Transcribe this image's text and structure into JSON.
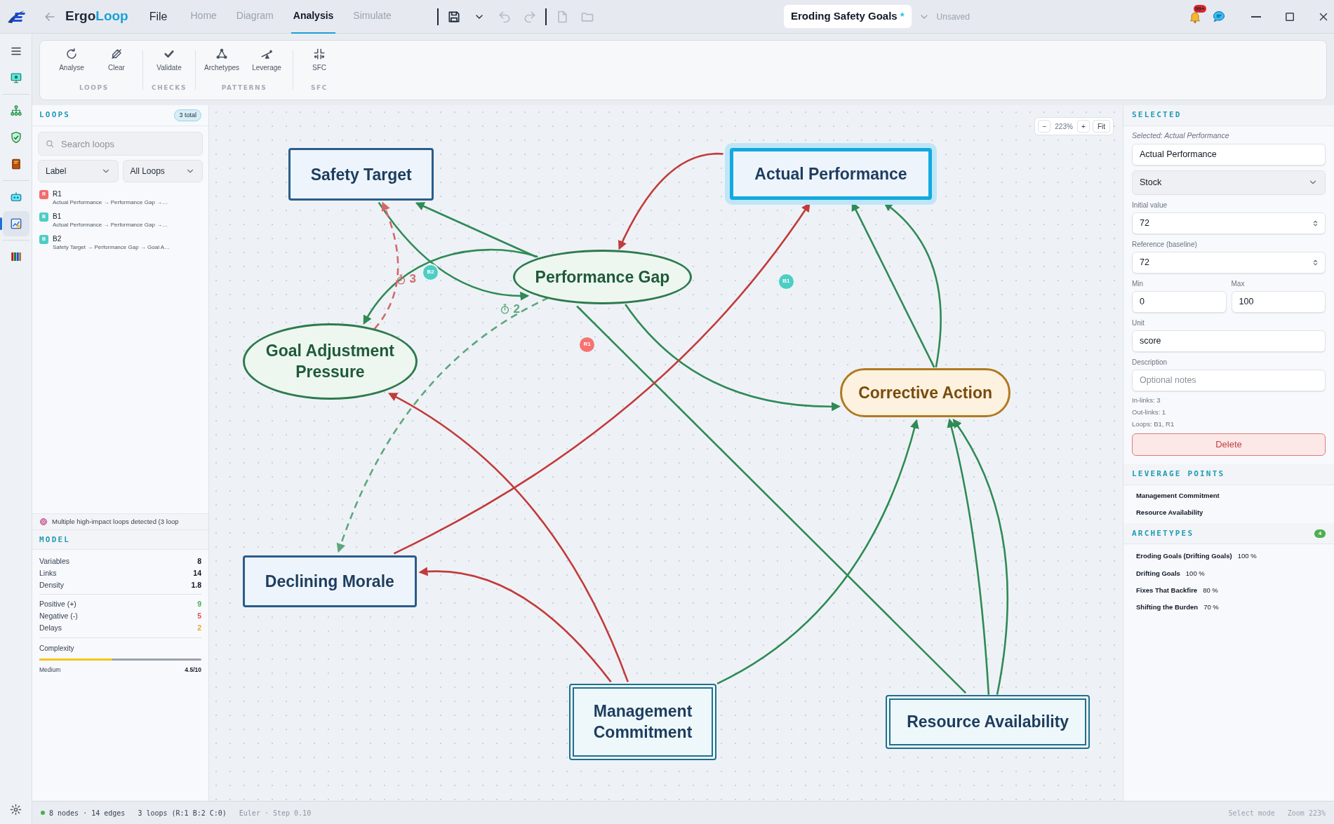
{
  "app": {
    "name_start": "Ergo",
    "name_end": "Loop"
  },
  "menu": {
    "label": "File"
  },
  "nav_tabs": [
    {
      "label": "Home",
      "selected": false
    },
    {
      "label": "Diagram",
      "selected": false
    },
    {
      "label": "Analysis",
      "selected": true
    },
    {
      "label": "Simulate",
      "selected": false
    }
  ],
  "quick_tools": [
    {
      "kind": "save",
      "disabled": false
    },
    {
      "kind": "dropdown",
      "disabled": false
    },
    {
      "kind": "undo",
      "disabled": true
    },
    {
      "kind": "redo",
      "disabled": true
    },
    {
      "kind": "new-file",
      "disabled": true
    },
    {
      "kind": "open-folder",
      "disabled": true
    }
  ],
  "document": {
    "title": "Eroding Safety Goals",
    "modified_mark": "*",
    "status": "Unsaved"
  },
  "notifications": {
    "count": "99+"
  },
  "rail": [
    {
      "items": [
        {
          "kind": "menu",
          "selected": false
        },
        {
          "kind": "monitor",
          "selected": false
        }
      ]
    },
    {
      "items": [
        {
          "kind": "network",
          "selected": false
        },
        {
          "kind": "shield",
          "selected": false
        },
        {
          "kind": "book",
          "selected": false
        }
      ]
    },
    {
      "items": [
        {
          "kind": "robot",
          "selected": false
        },
        {
          "kind": "dashboard",
          "selected": true
        }
      ]
    },
    {
      "items": [
        {
          "kind": "books",
          "selected": false
        }
      ]
    }
  ],
  "ribbon": [
    {
      "label": "LOOPS",
      "tools": [
        {
          "kind": "analyse",
          "label": "Analyse"
        },
        {
          "kind": "clear",
          "label": "Clear"
        }
      ]
    },
    {
      "label": "CHECKS",
      "tools": [
        {
          "kind": "validate",
          "label": "Validate"
        }
      ]
    },
    {
      "label": "PATTERNS",
      "tools": [
        {
          "kind": "archetypes",
          "label": "Archetypes"
        },
        {
          "kind": "leverage",
          "label": "Leverage"
        }
      ]
    },
    {
      "label": "SFC",
      "tools": [
        {
          "kind": "sfc",
          "label": "SFC"
        }
      ]
    }
  ],
  "loops_panel": {
    "title": "LOOPS",
    "count": "3 total",
    "search": {
      "placeholder": "Search loops"
    },
    "filters": [
      {
        "value": "Label"
      },
      {
        "value": "All Loops"
      }
    ],
    "loops": [
      {
        "letter": "R",
        "name": "R1",
        "path": "Actual Performance → Performance Gap →…",
        "color": "#f26d6d"
      },
      {
        "letter": "B",
        "name": "B1",
        "path": "Actual Performance → Performance Gap →…",
        "color": "#4ecdc4"
      },
      {
        "letter": "B",
        "name": "B2",
        "path": "Safety Target → Performance Gap → Goal A…",
        "color": "#4ecdc4"
      }
    ],
    "alert": "Multiple high-impact loops detected (3 loop"
  },
  "model": {
    "title": "MODEL",
    "stat_groups": [
      {
        "stats": [
          {
            "label": "Variables",
            "value": "8",
            "kind": "plain"
          },
          {
            "label": "Links",
            "value": "14",
            "kind": "plain"
          },
          {
            "label": "Density",
            "value": "1.8",
            "kind": "plain"
          }
        ]
      },
      {
        "stats": [
          {
            "label": "Positive (+)",
            "value": "9",
            "kind": "positive"
          },
          {
            "label": "Negative (-)",
            "value": "5",
            "kind": "negative"
          },
          {
            "label": "Delays",
            "value": "2",
            "kind": "delay"
          }
        ]
      }
    ],
    "complexity": {
      "label": "Complexity",
      "level": 0.45,
      "rating": "Medium",
      "score": "4.5/10"
    }
  },
  "canvas": {
    "nodes": [
      {
        "label": "Safety Target",
        "kind": "stock",
        "selected": false
      },
      {
        "label": "Actual Performance",
        "kind": "stock",
        "selected": true
      },
      {
        "label": "Performance Gap",
        "kind": "variable",
        "selected": false
      },
      {
        "label": "Goal Adjustment Pressure",
        "kind": "variable",
        "selected": false
      },
      {
        "label": "Corrective Action",
        "kind": "action",
        "selected": false
      },
      {
        "label": "Declining Morale",
        "kind": "stock",
        "selected": false
      },
      {
        "label": "Management Commitment",
        "kind": "lever",
        "selected": false
      },
      {
        "label": "Resource Availability",
        "kind": "lever",
        "selected": false
      }
    ],
    "links": [
      {
        "kind": "negative",
        "arrowhead": true
      },
      {
        "kind": "positive",
        "arrowhead": true
      },
      {
        "kind": "positive",
        "arrowhead": true
      },
      {
        "kind": "positive",
        "arrowhead": true
      },
      {
        "kind": "negative-delayed",
        "arrowhead": true,
        "delay": "3"
      },
      {
        "kind": "positive-delayed",
        "arrowhead": true,
        "delay": "2"
      },
      {
        "kind": "positive",
        "arrowhead": true
      },
      {
        "kind": "positive",
        "arrowhead": false
      },
      {
        "kind": "negative",
        "arrowhead": true
      },
      {
        "kind": "positive",
        "arrowhead": true
      },
      {
        "kind": "positive",
        "arrowhead": true
      },
      {
        "kind": "negative",
        "arrowhead": true
      },
      {
        "kind": "negative",
        "arrowhead": true
      },
      {
        "kind": "positive",
        "arrowhead": true
      },
      {
        "kind": "positive",
        "arrowhead": true
      },
      {
        "kind": "positive",
        "arrowhead": true
      }
    ],
    "loop_markers": [
      {
        "label": "B2",
        "color": "#4ecdc4"
      },
      {
        "label": "B1",
        "color": "#4ecdc4"
      },
      {
        "label": "R1",
        "color": "#f87171"
      }
    ],
    "zoom": {
      "out": "−",
      "value": "223%",
      "in": "+",
      "fit": "Fit"
    }
  },
  "inspector": {
    "title": "SELECTED",
    "caption": "Selected: Actual Performance",
    "name_value": "Actual Performance",
    "type_value": "Stock",
    "number_fields": [
      {
        "label": "Initial value",
        "value": "72"
      },
      {
        "label": "Reference (baseline)",
        "value": "72"
      }
    ],
    "range": [
      {
        "label": "Min",
        "value": "0"
      },
      {
        "label": "Max",
        "value": "100"
      }
    ],
    "unit": {
      "label": "Unit",
      "value": "score"
    },
    "description": {
      "label": "Description",
      "placeholder": "Optional notes"
    },
    "facts": [
      "In-links: 3",
      "Out-links: 1",
      "Loops: B1, R1"
    ],
    "delete": "Delete"
  },
  "leverage": {
    "title": "LEVERAGE POINTS",
    "items": [
      "Management Commitment",
      "Resource Availability"
    ]
  },
  "archetypes": {
    "title": "ARCHETYPES",
    "count": "4",
    "items": [
      {
        "name": "Eroding Goals (Drifting Goals)",
        "score": "100 %"
      },
      {
        "name": "Drifting Goals",
        "score": "100 %"
      },
      {
        "name": "Fixes That Backfire",
        "score": "80 %"
      },
      {
        "name": "Shifting the Burden",
        "score": "70 %"
      }
    ]
  },
  "status_bar": {
    "left": [
      {
        "text": "8 nodes · 14 edges",
        "muted": false
      },
      {
        "text": "3 loops (R:1 B:2 C:0)",
        "muted": false
      },
      {
        "text": "Euler · Step 0.10",
        "muted": true
      }
    ],
    "right": [
      {
        "text": "Select mode"
      },
      {
        "text": "Zoom 223%"
      }
    ]
  }
}
